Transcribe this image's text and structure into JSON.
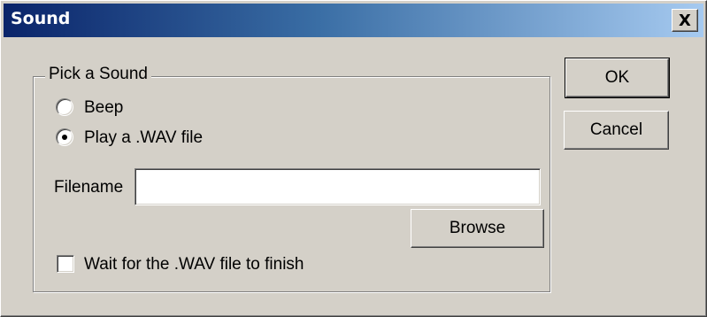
{
  "window": {
    "title": "Sound",
    "close_glyph": "X"
  },
  "group": {
    "legend": "Pick a Sound",
    "options": [
      {
        "label": "Beep",
        "selected": false
      },
      {
        "label": "Play a .WAV file",
        "selected": true
      }
    ]
  },
  "filename": {
    "label": "Filename",
    "value": ""
  },
  "buttons": {
    "ok": "OK",
    "cancel": "Cancel",
    "browse": "Browse"
  },
  "wait_checkbox": {
    "label": "Wait for the .WAV file to finish",
    "checked": false
  },
  "colors": {
    "face": "#d4d0c8",
    "title_start": "#0a246a",
    "title_end": "#a6caf0"
  }
}
